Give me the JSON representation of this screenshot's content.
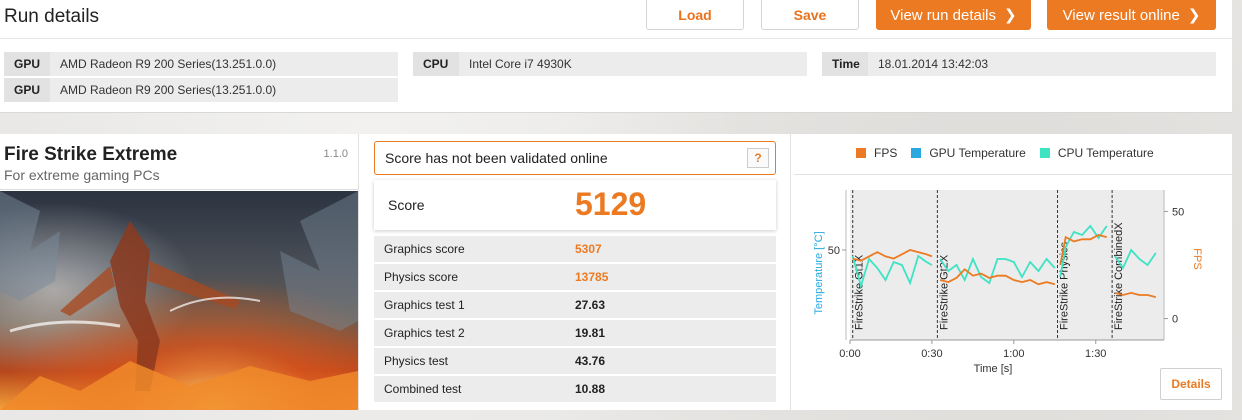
{
  "header": {
    "title": "Run details",
    "buttons": {
      "load": "Load",
      "save": "Save",
      "view_run": "View run details",
      "view_result": "View result online"
    }
  },
  "system_info": {
    "gpu_label": "GPU",
    "gpu1": "AMD Radeon R9 200 Series(13.251.0.0)",
    "gpu2": "AMD Radeon R9 200 Series(13.251.0.0)",
    "cpu_label": "CPU",
    "cpu": "Intel Core i7 4930K",
    "time_label": "Time",
    "time": "18.01.2014 13:42:03"
  },
  "test": {
    "name": "Fire Strike Extreme",
    "subtitle": "For extreme gaming PCs",
    "version": "1.1.0"
  },
  "validation": {
    "message": "Score has not been validated online",
    "help": "?"
  },
  "score": {
    "label": "Score",
    "value": "5129"
  },
  "results": [
    {
      "label": "Graphics score",
      "value": "5307"
    },
    {
      "label": "Physics score",
      "value": "13785"
    },
    {
      "label": "Graphics test 1",
      "value": "27.63"
    },
    {
      "label": "Graphics test 2",
      "value": "19.81"
    },
    {
      "label": "Physics test",
      "value": "43.76"
    },
    {
      "label": "Combined test",
      "value": "10.88"
    }
  ],
  "chart_data": {
    "type": "line",
    "legend": [
      "FPS",
      "GPU Temperature",
      "CPU Temperature"
    ],
    "legend_placement": "top",
    "colors": {
      "fps": "#ec7a22",
      "gpu_temp": "#29a9e0",
      "cpu_temp": "#3de3c3"
    },
    "xlabel": "Time [s]",
    "ylabel_left": "Temperature [°C]",
    "ylabel_right": "FPS",
    "x_ticks": [
      "0:00",
      "0:30",
      "1:00",
      "1:30"
    ],
    "y_left_ticks": [
      "50"
    ],
    "y_right_ticks": [
      "50",
      "0"
    ],
    "xlim": [
      0,
      115
    ],
    "y_left_lim": [
      20,
      70
    ],
    "y_right_lim": [
      -10,
      60
    ],
    "markers": [
      {
        "label": "FireStrike Gt1X",
        "x": 1
      },
      {
        "label": "FireStrike Gt2X",
        "x": 32
      },
      {
        "label": "FireStrike Physics",
        "x": 76
      },
      {
        "label": "FireStrike CombinedX",
        "x": 96
      }
    ],
    "series": [
      {
        "name": "FPS",
        "x": [
          1,
          4,
          7,
          10,
          13,
          16,
          19,
          22,
          25,
          28,
          30,
          33,
          36,
          39,
          42,
          45,
          48,
          51,
          54,
          57,
          60,
          63,
          66,
          69,
          72,
          75,
          77,
          79,
          82,
          85,
          88,
          91,
          94,
          97,
          100,
          103,
          106,
          109,
          112
        ],
        "values": [
          28,
          27,
          29,
          31,
          29,
          28,
          30,
          32,
          31,
          30,
          29,
          18,
          17,
          19,
          23,
          20,
          21,
          19,
          20,
          20,
          18,
          17,
          18,
          16,
          17,
          16,
          25,
          38,
          36,
          37,
          37,
          39,
          38,
          12,
          11,
          12,
          11,
          11,
          10
        ]
      },
      {
        "name": "CPU Temperature",
        "x": [
          1,
          4,
          7,
          10,
          13,
          16,
          19,
          22,
          25,
          28,
          30,
          33,
          36,
          39,
          42,
          45,
          48,
          51,
          54,
          57,
          60,
          63,
          66,
          69,
          72,
          75,
          77,
          79,
          82,
          85,
          88,
          91,
          94,
          97,
          100,
          103,
          106,
          109,
          112
        ],
        "values": [
          48,
          38,
          47,
          44,
          40,
          46,
          45,
          39,
          48,
          46,
          45,
          47,
          43,
          45,
          40,
          47,
          41,
          39,
          47,
          47,
          46,
          41,
          46,
          43,
          47,
          44,
          41,
          51,
          56,
          55,
          58,
          54,
          58,
          48,
          44,
          50,
          47,
          45,
          49
        ]
      }
    ]
  }
}
